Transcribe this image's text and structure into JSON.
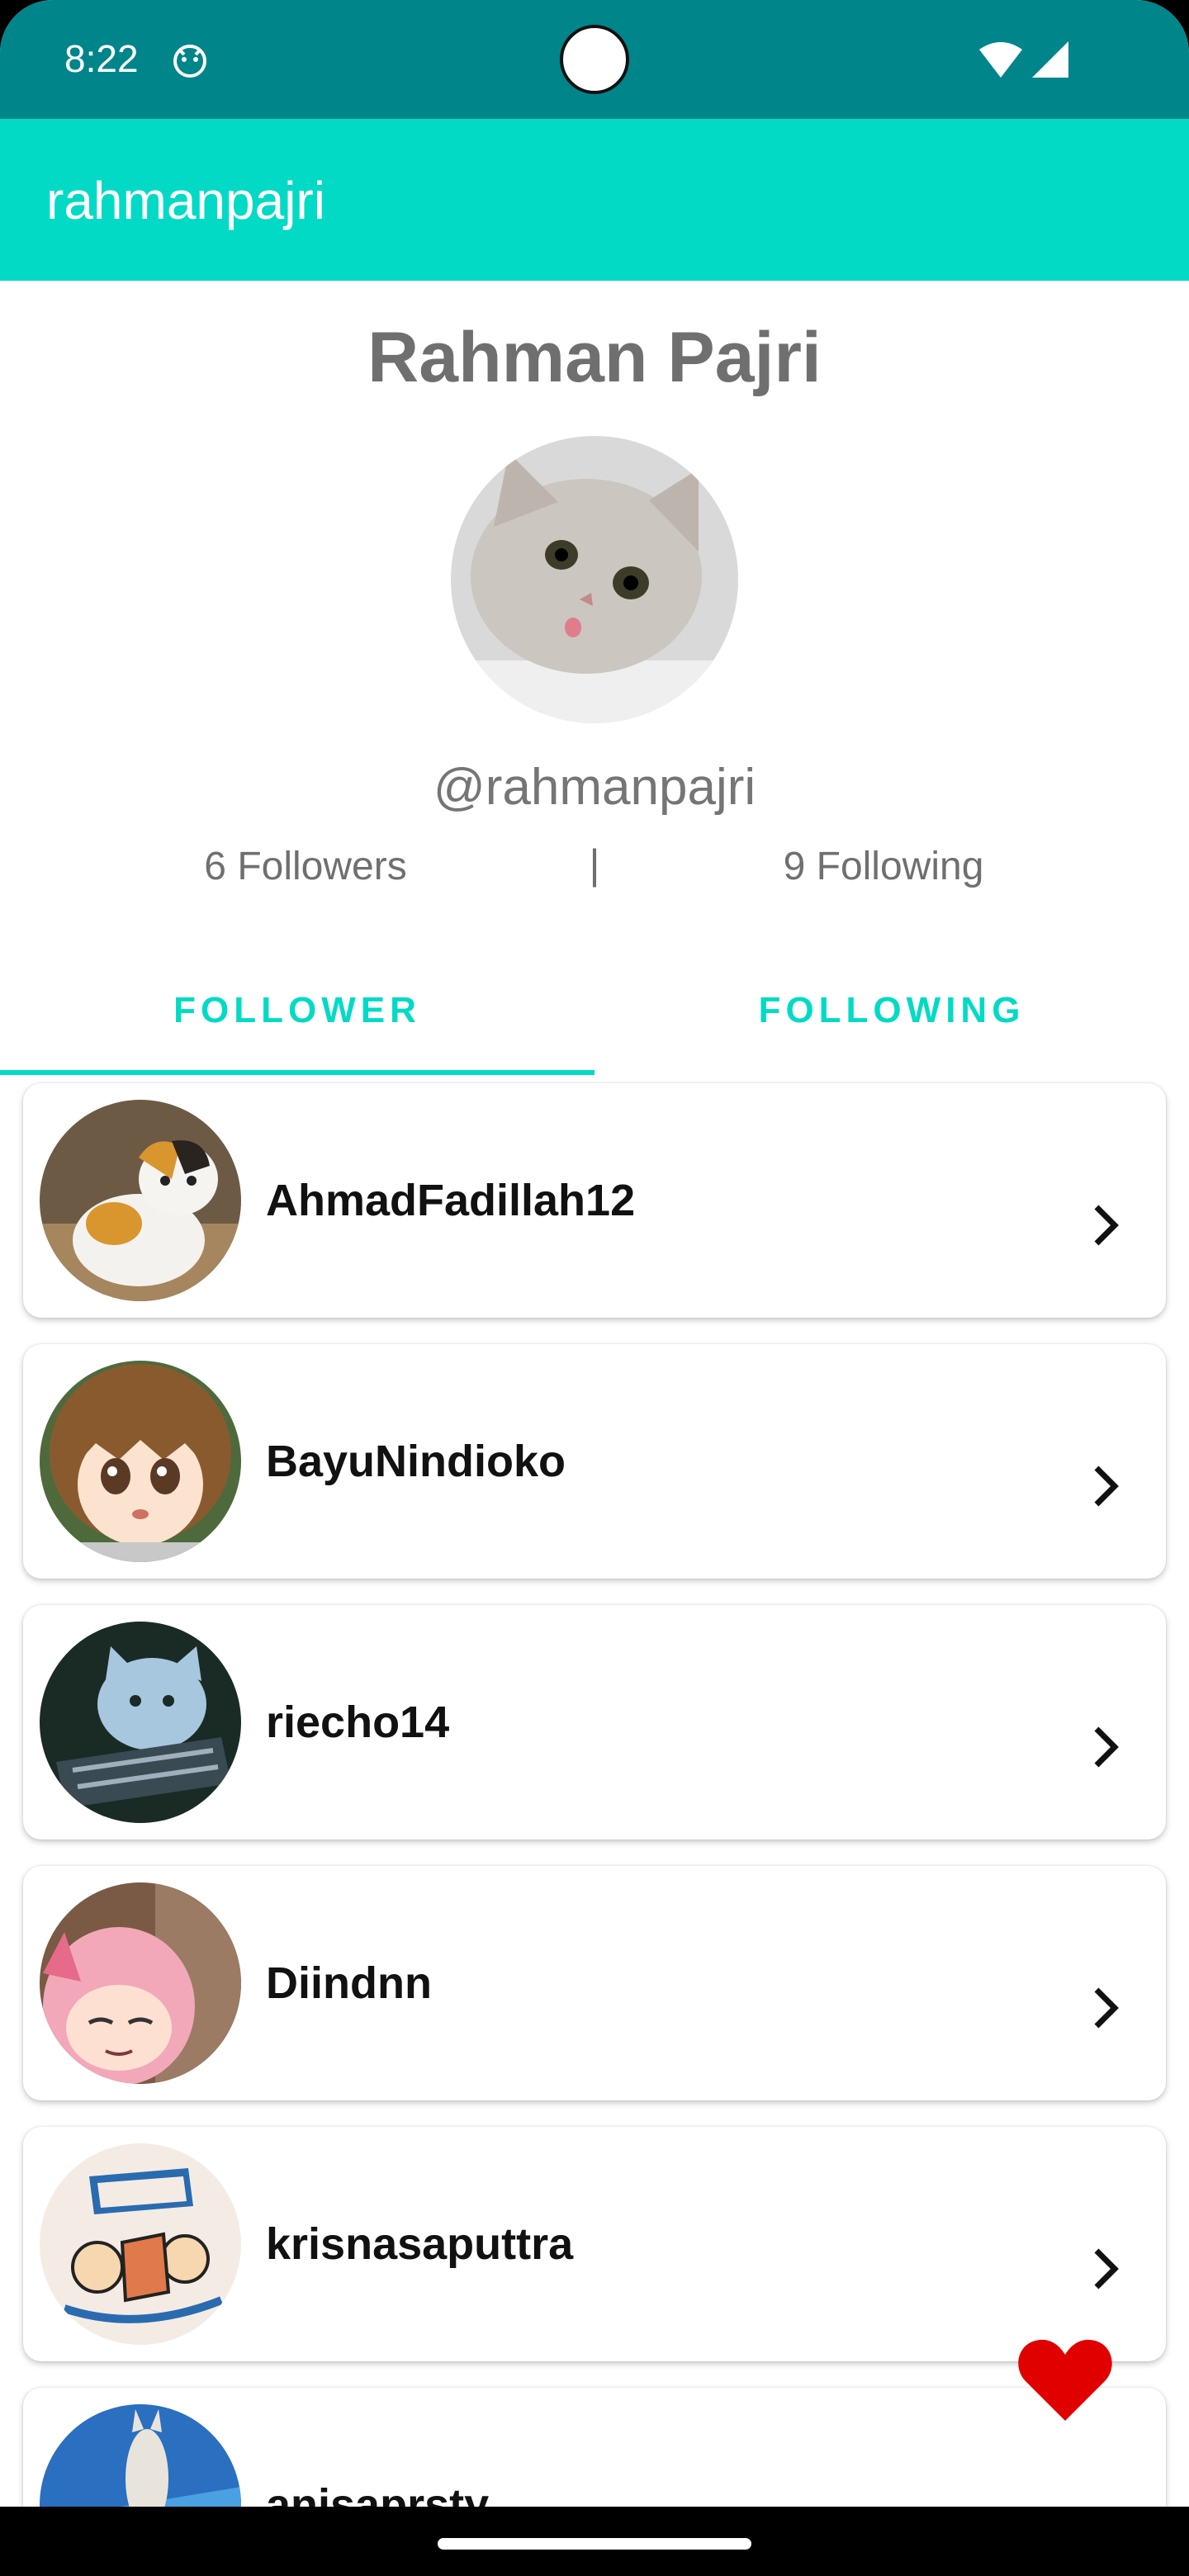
{
  "status_bar": {
    "time": "8:22",
    "app_icon": "android-app-icon",
    "wifi_icon": "wifi-icon",
    "signal_icon": "cell-signal-icon"
  },
  "app_bar": {
    "title": "rahmanpajri"
  },
  "profile": {
    "name": "Rahman Pajri",
    "username": "@rahmanpajri",
    "followers": "6 Followers",
    "divider": "|",
    "following": "9 Following"
  },
  "tabs": [
    {
      "label": "FOLLOWER",
      "selected": true
    },
    {
      "label": "FOLLOWING",
      "selected": false
    }
  ],
  "followers": [
    {
      "username": "AhmadFadillah12",
      "avatar": "calico-kitten-avatar"
    },
    {
      "username": "BayuNindioko",
      "avatar": "anime-girl-avatar"
    },
    {
      "username": "riecho14",
      "avatar": "blue-cat-keyboard-avatar"
    },
    {
      "username": "Diindnn",
      "avatar": "pink-hair-anime-avatar"
    },
    {
      "username": "krisnasaputtra",
      "avatar": "playball-cartoon-avatar"
    },
    {
      "username": "anisaprsty",
      "avatar": "llama-avatar"
    }
  ],
  "fab": {
    "icon": "heart-icon"
  },
  "colors": {
    "status_bar": "#00858a",
    "app_bar": "#03dac5",
    "accent": "#03dac5",
    "heart": "#e00000"
  }
}
